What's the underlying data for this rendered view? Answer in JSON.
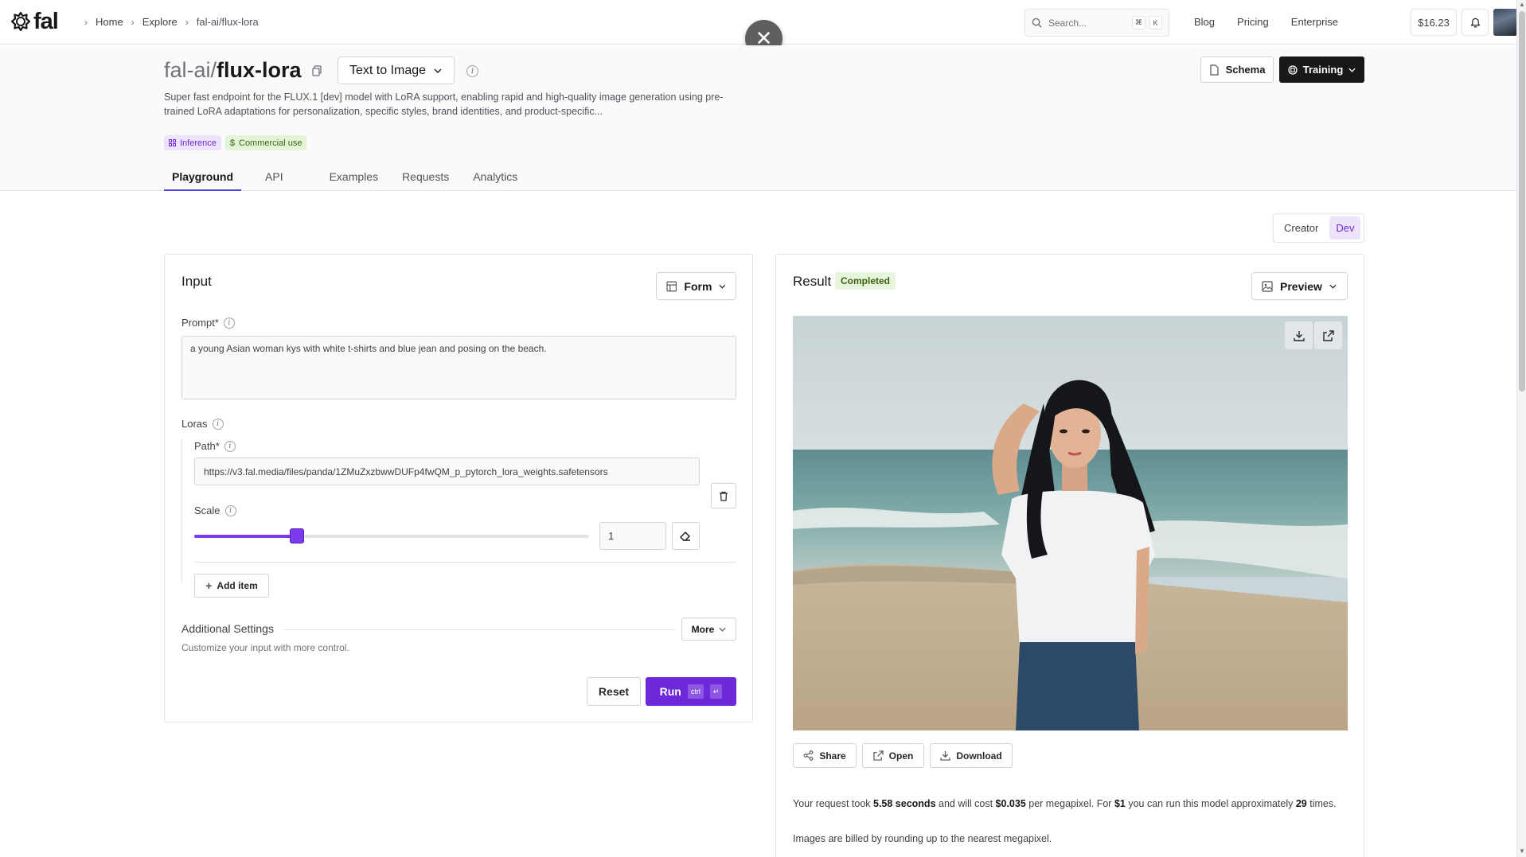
{
  "nav": {
    "logo_text": "fal",
    "breadcrumbs": [
      "Home",
      "Explore",
      "fal-ai/flux-lora"
    ],
    "search": {
      "placeholder": "Search...",
      "kbd1": "⌘",
      "kbd2": "K"
    },
    "links": [
      "Blog",
      "Pricing",
      "Enterprise"
    ],
    "balance": "$16.23"
  },
  "overlay": {
    "close_glyph": "✕"
  },
  "model": {
    "namespace": "fal-ai/",
    "name": "flux-lora",
    "type_select": "Text to Image",
    "description": "Super fast endpoint for the FLUX.1 [dev] model with LoRA support, enabling rapid and high-quality image generation using pre-trained LoRA adaptations for personalization, specific styles, brand identities, and product-specific...",
    "tags": [
      {
        "label": "Inference",
        "icon": "grid-icon"
      },
      {
        "label": "Commercial use",
        "icon": "dollar-icon"
      }
    ],
    "schema_label": "Schema",
    "training_label": "Training",
    "tabs": [
      "Playground",
      "API",
      "Examples",
      "Requests",
      "Analytics"
    ],
    "active_tab": "Playground"
  },
  "mode_toggle": {
    "options": [
      "Creator",
      "Dev"
    ],
    "active": "Dev"
  },
  "input_panel": {
    "title": "Input",
    "view_select": "Form",
    "prompt_label": "Prompt*",
    "prompt_value": "a young Asian woman kys with white t-shirts and blue jean and posing on the beach.",
    "loras_label": "Loras",
    "path_label": "Path*",
    "path_value": "https://v3.fal.media/files/panda/1ZMuZxzbwwDUFp4fwQM_p_pytorch_lora_weights.safetensors",
    "scale_label": "Scale",
    "scale_value": "1",
    "slider_fraction": 0.26,
    "add_item_label": "Add item",
    "additional_title": "Additional Settings",
    "additional_sub": "Customize your input with more control.",
    "more_label": "More",
    "reset_label": "Reset",
    "run_label": "Run",
    "run_kbd1": "ctrl",
    "run_kbd2": "↵"
  },
  "result_panel": {
    "title": "Result",
    "status": "Completed",
    "view_select": "Preview",
    "actions": [
      "Share",
      "Open",
      "Download"
    ],
    "cost": {
      "p1": "Your request took ",
      "seconds": "5.58 seconds",
      "p2": " and will cost ",
      "price": "$0.035",
      "p3": " per megapixel. For ",
      "dollar": "$1",
      "p4": " you can run this model approximately ",
      "runs": "29",
      "p5": " times."
    },
    "billing_note": "Images are billed by rounding up to the nearest megapixel."
  },
  "colors": {
    "accent": "#6d28d9",
    "status_green_bg": "#e7f5dd",
    "inference_bg": "#ede4fb"
  }
}
